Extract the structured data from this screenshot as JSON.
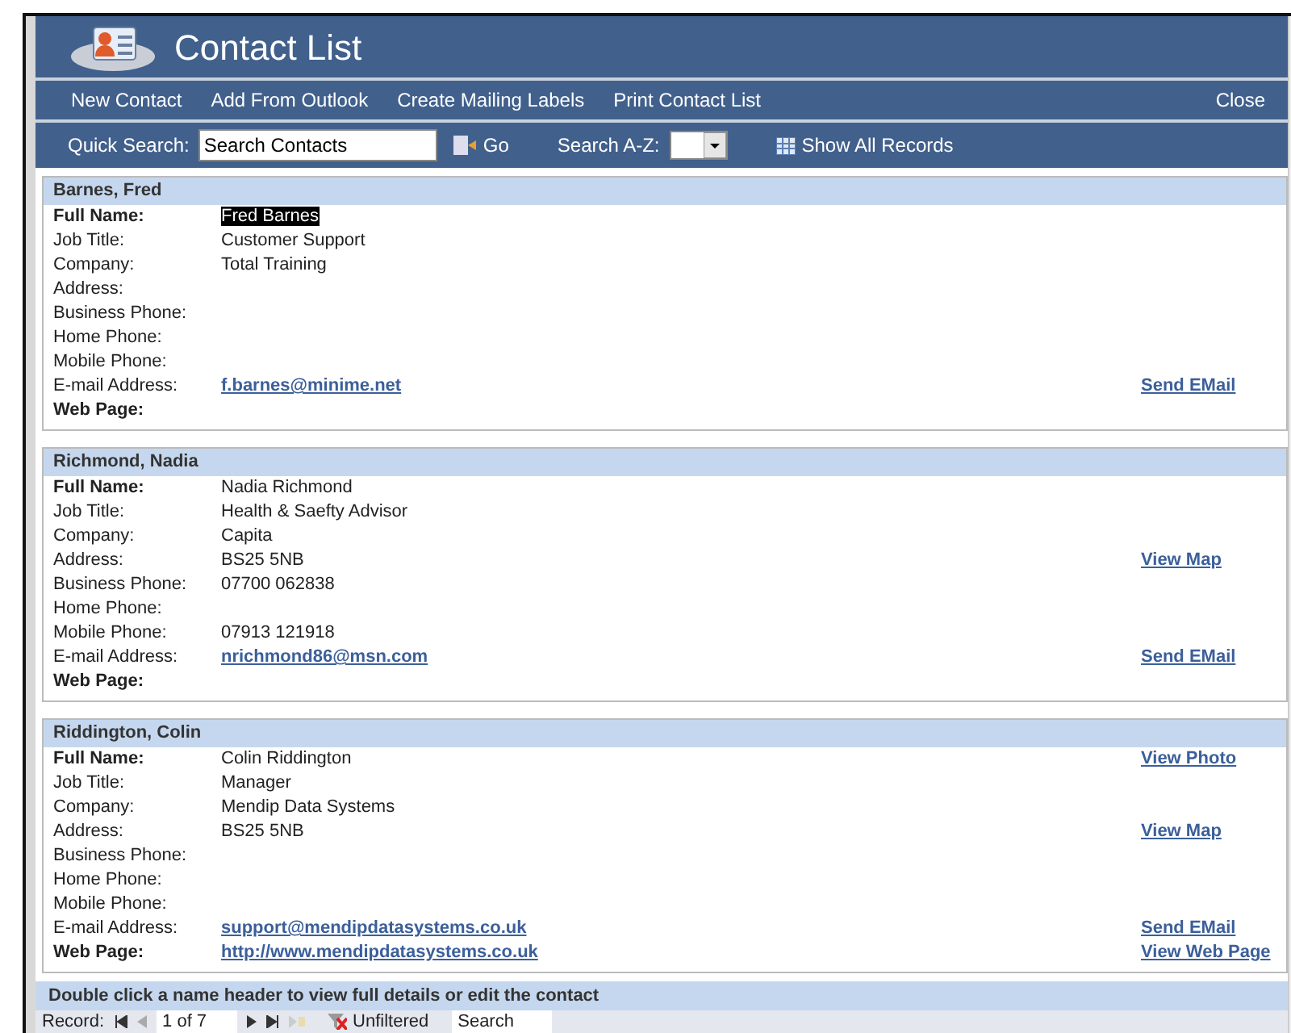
{
  "window": {
    "title": "Contact List"
  },
  "menu": [
    {
      "label": "New Contact"
    },
    {
      "label": "Add From Outlook"
    },
    {
      "label": "Create Mailing Labels"
    },
    {
      "label": "Print Contact List"
    },
    {
      "label": "Close"
    }
  ],
  "search_bar": {
    "quick_search_label": "Quick Search:",
    "search_field": {
      "value": "Search Contacts"
    },
    "go_button": "Go",
    "az_label": "Search A-Z:",
    "show_all_button": "Show All Records"
  },
  "records": [
    {
      "header": "Barnes, Fred",
      "fields": [
        {
          "label": "Full Name:",
          "bold": true,
          "value": "Fred Barnes",
          "kind": "text",
          "selected": true
        },
        {
          "label": "Job Title:",
          "bold": false,
          "value": "Customer Support",
          "kind": "text",
          "selected": false
        },
        {
          "label": "Company:",
          "bold": false,
          "value": "Total Training",
          "kind": "text",
          "selected": false
        },
        {
          "label": "Address:",
          "bold": false
        },
        {
          "label": "Business Phone:",
          "bold": false
        },
        {
          "label": "Home Phone:",
          "bold": false
        },
        {
          "label": "Mobile Phone:",
          "bold": false
        },
        {
          "label": "E-mail Address:",
          "bold": false,
          "value": "f.barnes@minime.net",
          "kind": "link",
          "selected": false,
          "action": "Send EMail"
        },
        {
          "label": "Web Page:",
          "bold": true
        }
      ]
    },
    {
      "header": "Richmond, Nadia",
      "fields": [
        {
          "label": "Full Name:",
          "bold": true,
          "value": "Nadia Richmond",
          "kind": "text",
          "selected": false
        },
        {
          "label": "Job Title:",
          "bold": false,
          "value": "Health & Saefty Advisor",
          "kind": "text",
          "selected": false
        },
        {
          "label": "Company:",
          "bold": false,
          "value": "Capita",
          "kind": "text",
          "selected": false
        },
        {
          "label": "Address:",
          "bold": false,
          "value": "BS25 5NB",
          "kind": "text",
          "selected": false,
          "action": "View Map"
        },
        {
          "label": "Business Phone:",
          "bold": false,
          "value": "07700 062838",
          "kind": "text",
          "selected": false
        },
        {
          "label": "Home Phone:",
          "bold": false
        },
        {
          "label": "Mobile Phone:",
          "bold": false,
          "value": "07913 121918",
          "kind": "text",
          "selected": false
        },
        {
          "label": "E-mail Address:",
          "bold": false,
          "value": "nrichmond86@msn.com",
          "kind": "link",
          "selected": false,
          "action": "Send EMail"
        },
        {
          "label": "Web Page:",
          "bold": true
        }
      ]
    },
    {
      "header": "Riddington, Colin",
      "fields": [
        {
          "label": "Full Name:",
          "bold": true,
          "value": "Colin Riddington",
          "kind": "text",
          "selected": false,
          "action": "View Photo"
        },
        {
          "label": "Job Title:",
          "bold": false,
          "value": "Manager",
          "kind": "text",
          "selected": false
        },
        {
          "label": "Company:",
          "bold": false,
          "value": "Mendip Data Systems",
          "kind": "text",
          "selected": false
        },
        {
          "label": "Address:",
          "bold": false,
          "value": "BS25 5NB",
          "kind": "text",
          "selected": false,
          "action": "View Map"
        },
        {
          "label": "Business Phone:",
          "bold": false
        },
        {
          "label": "Home Phone:",
          "bold": false
        },
        {
          "label": "Mobile Phone:",
          "bold": false
        },
        {
          "label": "E-mail Address:",
          "bold": false,
          "value": "support@mendipdatasystems.co.uk",
          "kind": "link",
          "selected": false,
          "action": "Send EMail"
        },
        {
          "label": "Web Page:",
          "bold": true,
          "value": "http://www.mendipdatasystems.co.uk",
          "kind": "link",
          "selected": false,
          "action": "View Web Page"
        }
      ]
    }
  ],
  "footer_hint": "Double click a name header to view full details or edit the contact",
  "navigation": {
    "label": "Record:",
    "position": "1 of 7",
    "filter": "Unfiltered",
    "search": "Search"
  }
}
